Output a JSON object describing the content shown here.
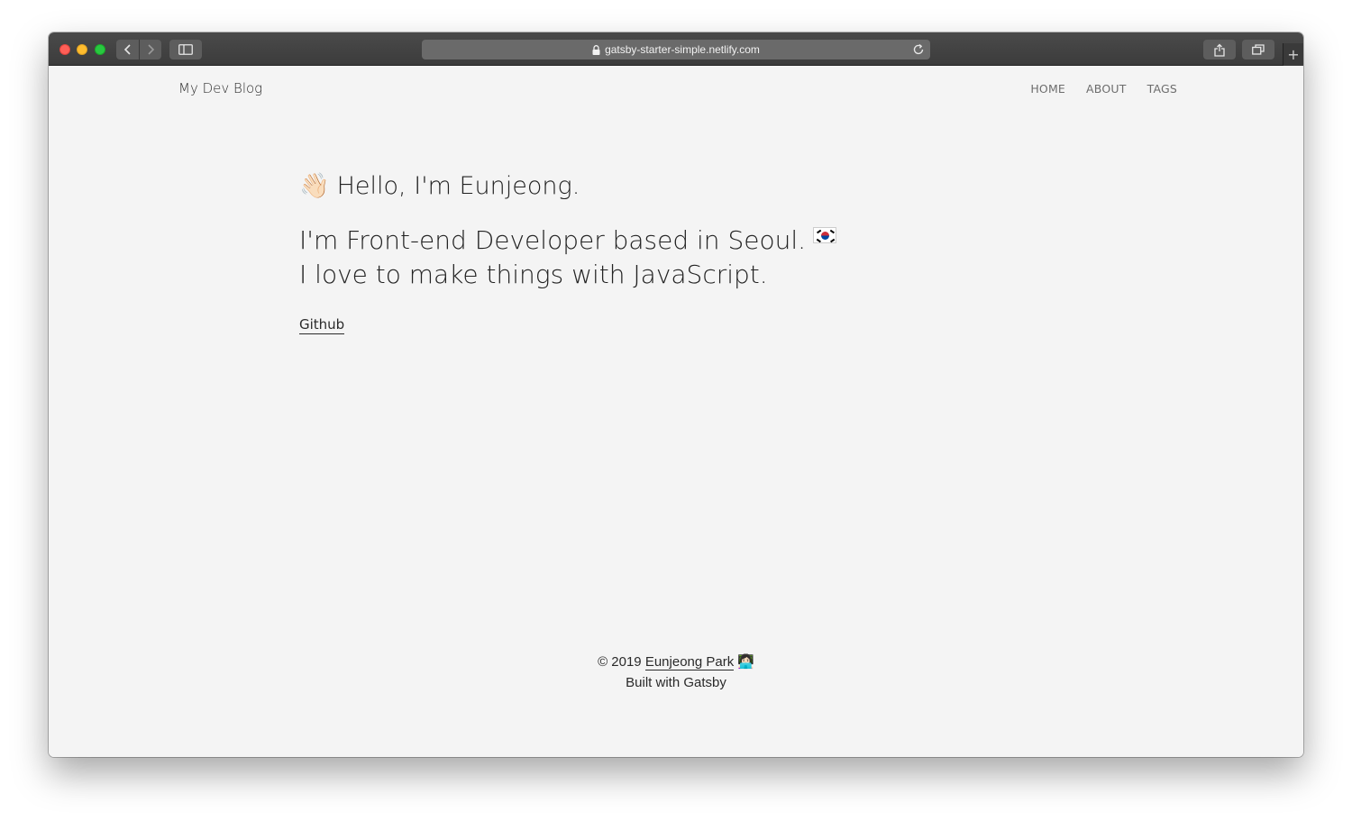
{
  "browser": {
    "url": "gatsby-starter-simple.netlify.com",
    "icons": {
      "back": "chevron-left-icon",
      "forward": "chevron-right-icon",
      "sidebar": "sidebar-icon",
      "lock": "lock-icon",
      "reload": "reload-icon",
      "share": "share-icon",
      "tabs": "tabs-icon",
      "new_tab": "plus-icon"
    },
    "new_tab_label": "+"
  },
  "header": {
    "site_title": "My Dev Blog",
    "nav": [
      {
        "label": "HOME"
      },
      {
        "label": "ABOUT"
      },
      {
        "label": "TAGS"
      }
    ]
  },
  "hero": {
    "wave_emoji": "👋🏻",
    "greeting": "Hello, I'm Eunjeong.",
    "intro_line1": "I'm Front-end Developer based in Seoul.",
    "intro_line2": "I love to make things with JavaScript.",
    "github_link": "Github"
  },
  "footer": {
    "copyright": "© 2019",
    "author": "Eunjeong Park",
    "dev_emoji": "👩🏻‍💻",
    "built_with": "Built with Gatsby"
  },
  "colors": {
    "background": "#f4f4f4",
    "text": "#222222",
    "nav_text": "#6d6d6d",
    "toolbar": "#3c3c3c"
  }
}
